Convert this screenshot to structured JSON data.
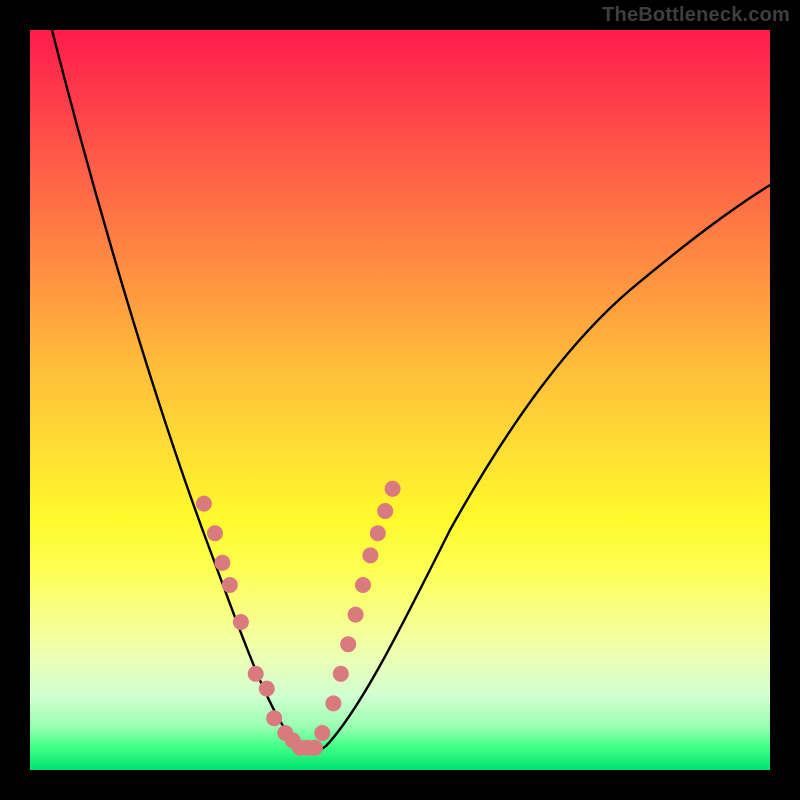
{
  "watermark": "TheBottleneck.com",
  "chart_data": {
    "type": "line",
    "title": "",
    "xlabel": "",
    "ylabel": "",
    "xlim": [
      0,
      100
    ],
    "ylim": [
      0,
      100
    ],
    "series": [
      {
        "name": "curve",
        "color": "#000000",
        "x": [
          3,
          6,
          9,
          12,
          15,
          18,
          21,
          24,
          27,
          30,
          33,
          36,
          39,
          42,
          45,
          48,
          51,
          54,
          57,
          60,
          65,
          70,
          75,
          80,
          85,
          90,
          95,
          100
        ],
        "y": [
          100,
          90,
          80,
          71,
          62,
          54,
          46,
          38,
          30,
          22,
          14,
          7,
          3,
          13,
          22,
          31,
          39,
          46,
          52,
          57,
          63,
          68,
          71,
          74,
          76,
          78,
          79,
          80
        ]
      }
    ],
    "markers": [
      {
        "name": "dots",
        "color": "#d97b7e",
        "radius": 8,
        "points": [
          {
            "x": 23.5,
            "y": 36
          },
          {
            "x": 25.0,
            "y": 32
          },
          {
            "x": 26.0,
            "y": 28
          },
          {
            "x": 27.0,
            "y": 25
          },
          {
            "x": 28.5,
            "y": 20
          },
          {
            "x": 30.5,
            "y": 13
          },
          {
            "x": 32.0,
            "y": 11
          },
          {
            "x": 33.0,
            "y": 7
          },
          {
            "x": 34.5,
            "y": 5
          },
          {
            "x": 35.5,
            "y": 4
          },
          {
            "x": 36.5,
            "y": 3
          },
          {
            "x": 37.5,
            "y": 3
          },
          {
            "x": 38.5,
            "y": 3
          },
          {
            "x": 39.5,
            "y": 5
          },
          {
            "x": 41.0,
            "y": 9
          },
          {
            "x": 42.0,
            "y": 13
          },
          {
            "x": 43.0,
            "y": 17
          },
          {
            "x": 44.0,
            "y": 21
          },
          {
            "x": 45.0,
            "y": 25
          },
          {
            "x": 46.0,
            "y": 29
          },
          {
            "x": 47.0,
            "y": 32
          },
          {
            "x": 48.0,
            "y": 35
          },
          {
            "x": 49.0,
            "y": 38
          }
        ]
      }
    ],
    "gradient_stops": [
      {
        "pos": 0,
        "color": "#ff1b4b"
      },
      {
        "pos": 50,
        "color": "#ffd33a"
      },
      {
        "pos": 75,
        "color": "#fdff60"
      },
      {
        "pos": 100,
        "color": "#00e26f"
      }
    ]
  }
}
